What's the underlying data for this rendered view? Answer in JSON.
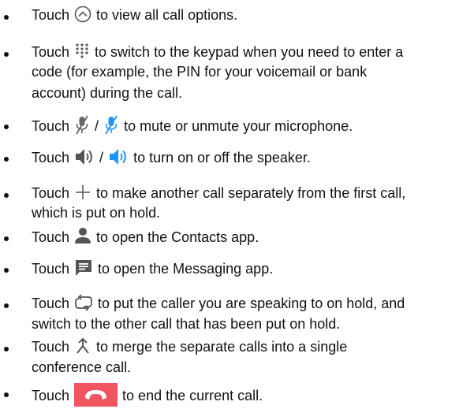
{
  "colors": {
    "icon_gray": "#555555",
    "icon_blue": "#2196f3",
    "end_call_red": "#f05560",
    "text": "#111111"
  },
  "items": [
    {
      "icon": "chevron-up-circle-icon",
      "before": "Touch",
      "after": "to view all call options."
    },
    {
      "icon": "dialpad-icon",
      "before": "Touch",
      "after": "to switch to the keypad when you need to enter a",
      "continuation": [
        "code (for example, the PIN for your voicemail or bank",
        "account) during the call."
      ]
    },
    {
      "icon": "mute-icon",
      "icon_alt": "mute-active-icon",
      "before": "Touch",
      "separator": "/",
      "after": "to mute or unmute your microphone."
    },
    {
      "icon": "speaker-icon",
      "icon_alt": "speaker-active-icon",
      "before": "Touch",
      "separator": "/",
      "after": "to turn on or off the speaker."
    },
    {
      "icon": "plus-icon",
      "before": "Touch",
      "after": "to make another call separately from the first call,",
      "continuation": [
        "which is put on hold."
      ]
    },
    {
      "icon": "contact-person-icon",
      "before": "Touch",
      "after": "to open the Contacts app."
    },
    {
      "icon": "message-icon",
      "before": "Touch",
      "after": "to open the Messaging app."
    },
    {
      "icon": "swap-calls-icon",
      "before": "Touch",
      "after": "to put the caller you are speaking to on hold, and",
      "continuation": [
        "switch to the other call that has been put on hold."
      ]
    },
    {
      "icon": "merge-calls-icon",
      "before": "Touch",
      "after": "to merge the separate calls into a single",
      "continuation": [
        "conference call."
      ]
    },
    {
      "icon": "end-call-icon",
      "before": "Touch",
      "after": "to end the current call."
    }
  ]
}
